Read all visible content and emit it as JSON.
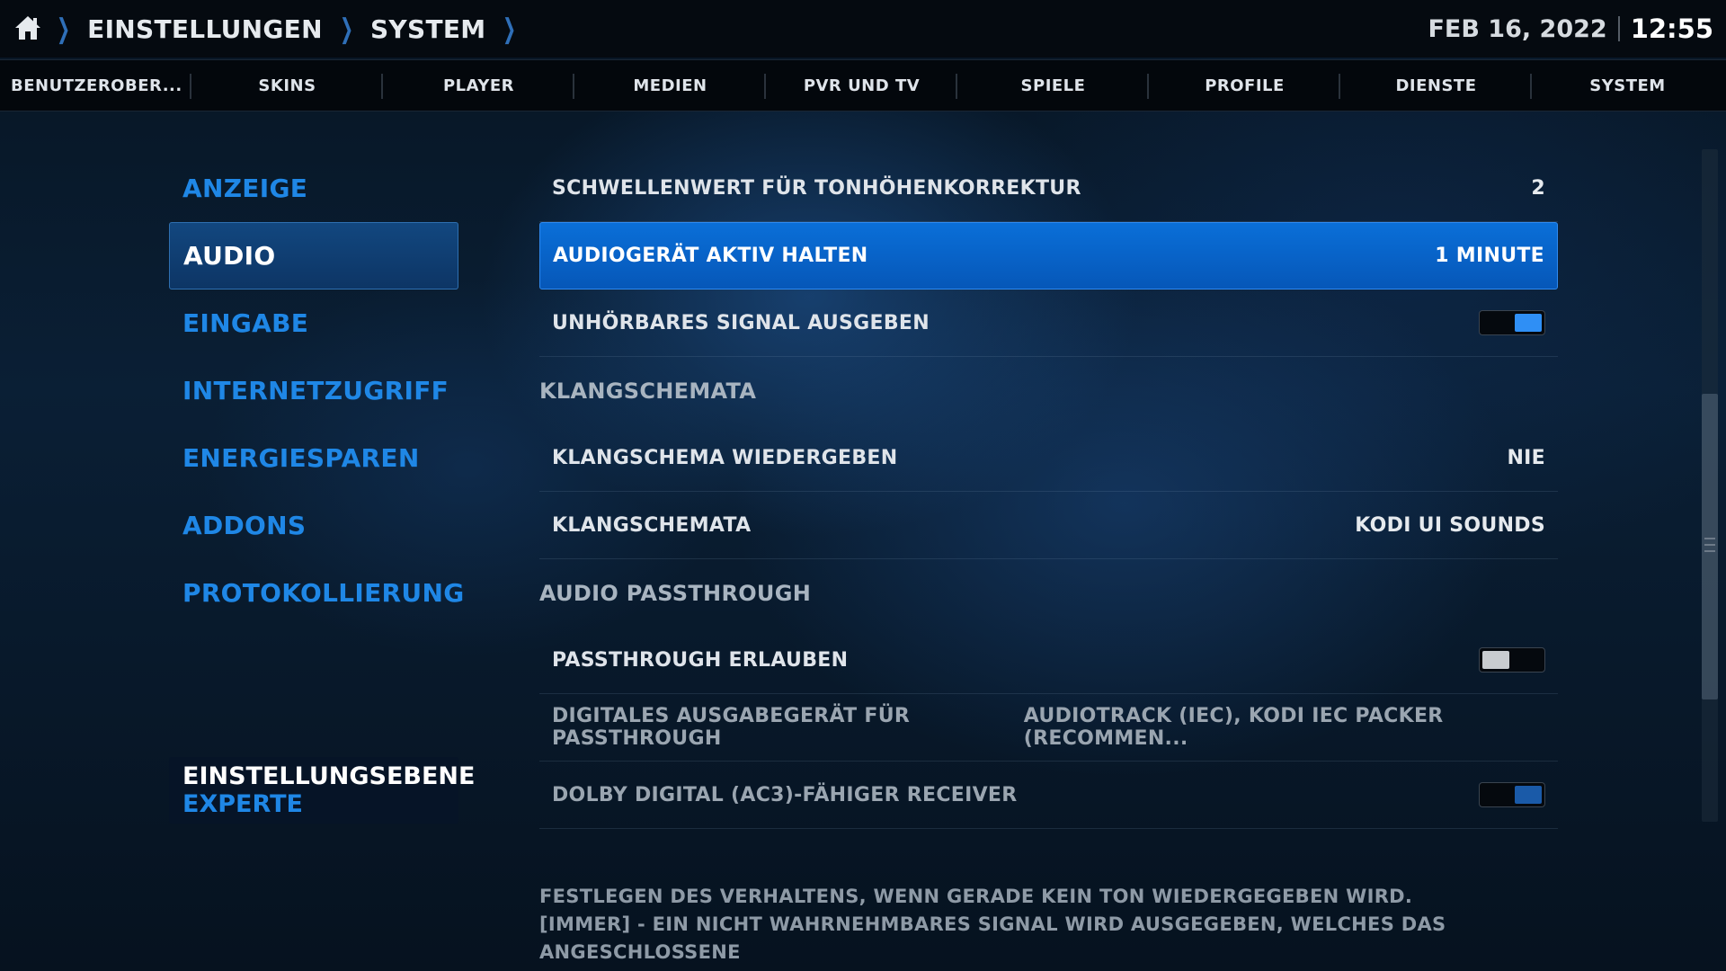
{
  "breadcrumb": {
    "items": [
      "EINSTELLUNGEN",
      "SYSTEM"
    ]
  },
  "clock": {
    "date": "FEB 16, 2022",
    "time": "12:55"
  },
  "tabs": [
    {
      "label": "BENUTZEROBER..."
    },
    {
      "label": "SKINS"
    },
    {
      "label": "PLAYER"
    },
    {
      "label": "MEDIEN"
    },
    {
      "label": "PVR UND TV"
    },
    {
      "label": "SPIELE"
    },
    {
      "label": "PROFILE"
    },
    {
      "label": "DIENSTE"
    },
    {
      "label": "SYSTEM"
    }
  ],
  "menu": {
    "items": [
      {
        "label": "ANZEIGE"
      },
      {
        "label": "AUDIO",
        "active": true
      },
      {
        "label": "EINGABE"
      },
      {
        "label": "INTERNETZUGRIFF"
      },
      {
        "label": "ENERGIESPAREN"
      },
      {
        "label": "ADDONS"
      },
      {
        "label": "PROTOKOLLIERUNG"
      }
    ]
  },
  "settings_level": {
    "title": "EINSTELLUNGSEBENE",
    "value": "EXPERTE"
  },
  "settings": {
    "pitch_threshold": {
      "label": "SCHWELLENWERT FÜR TONHÖHENKORREKTUR",
      "value": "2"
    },
    "keep_alive": {
      "label": "AUDIOGERÄT AKTIV HALTEN",
      "value": "1 MINUTE"
    },
    "inaudible_signal": {
      "label": "UNHÖRBARES SIGNAL AUSGEBEN",
      "state": "on"
    },
    "section_sounds": "KLANGSCHEMATA",
    "play_gui_sounds": {
      "label": "KLANGSCHEMA WIEDERGEBEN",
      "value": "NIE"
    },
    "sound_scheme": {
      "label": "KLANGSCHEMATA",
      "value": "KODI UI SOUNDS"
    },
    "section_passthrough": "AUDIO PASSTHROUGH",
    "allow_passthrough": {
      "label": "PASSTHROUGH ERLAUBEN",
      "state": "off"
    },
    "passthrough_device": {
      "label": "DIGITALES AUSGABEGERÄT FÜR PASSTHROUGH",
      "value": "AUDIOTRACK (IEC), KODI IEC PACKER (RECOMMEN..."
    },
    "ac3_receiver": {
      "label": "DOLBY DIGITAL (AC3)-FÄHIGER RECEIVER",
      "state": "on"
    }
  },
  "description": {
    "line1": "FESTLEGEN DES VERHALTENS, WENN GERADE KEIN TON WIEDERGEGEBEN WIRD.",
    "line2": "[IMMER] - EIN NICHT WAHRNEHMBARES SIGNAL WIRD AUSGEGEBEN, WELCHES DAS ANGESCHLOSSENE"
  },
  "colors": {
    "accent": "#1f87e6",
    "selected_row": "#0a6fd8",
    "background": "#04101c"
  }
}
